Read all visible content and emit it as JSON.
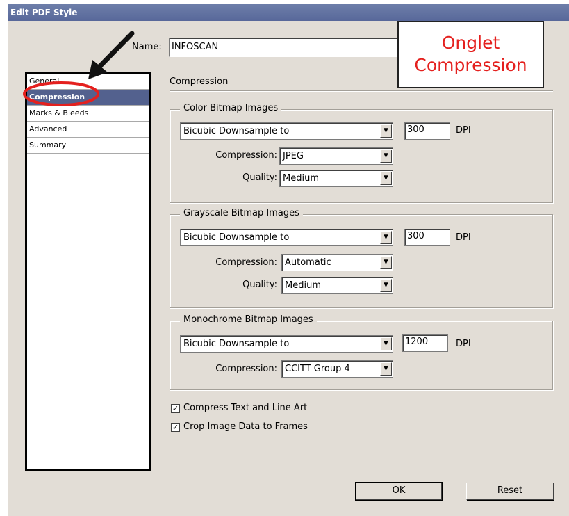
{
  "window": {
    "title": "Edit PDF Style"
  },
  "name_field": {
    "label": "Name:",
    "value": "INFOSCAN"
  },
  "sidebar": {
    "items": [
      {
        "label": "General"
      },
      {
        "label": "Compression",
        "selected": true
      },
      {
        "label": "Marks & Bleeds"
      },
      {
        "label": "Advanced"
      },
      {
        "label": "Summary"
      }
    ]
  },
  "section": {
    "title": "Compression"
  },
  "color_group": {
    "title": "Color Bitmap Images",
    "sampling": "Bicubic Downsample to",
    "dpi": "300",
    "dpi_label": "DPI",
    "compression_label": "Compression:",
    "compression": "JPEG",
    "quality_label": "Quality:",
    "quality": "Medium"
  },
  "grayscale_group": {
    "title": "Grayscale Bitmap Images",
    "sampling": "Bicubic Downsample to",
    "dpi": "300",
    "dpi_label": "DPI",
    "compression_label": "Compression:",
    "compression": "Automatic",
    "quality_label": "Quality:",
    "quality": "Medium"
  },
  "mono_group": {
    "title": "Monochrome Bitmap Images",
    "sampling": "Bicubic Downsample to",
    "dpi": "1200",
    "dpi_label": "DPI",
    "compression_label": "Compression:",
    "compression": "CCITT Group 4"
  },
  "options": {
    "compress_text": {
      "label": "Compress Text and Line Art",
      "checked": true
    },
    "crop_image": {
      "label": "Crop Image Data to Frames",
      "checked": true
    }
  },
  "buttons": {
    "ok": "OK",
    "reset": "Reset"
  },
  "annotation": {
    "line1": "Onglet",
    "line2": "Compression",
    "color": "#e4201e"
  }
}
